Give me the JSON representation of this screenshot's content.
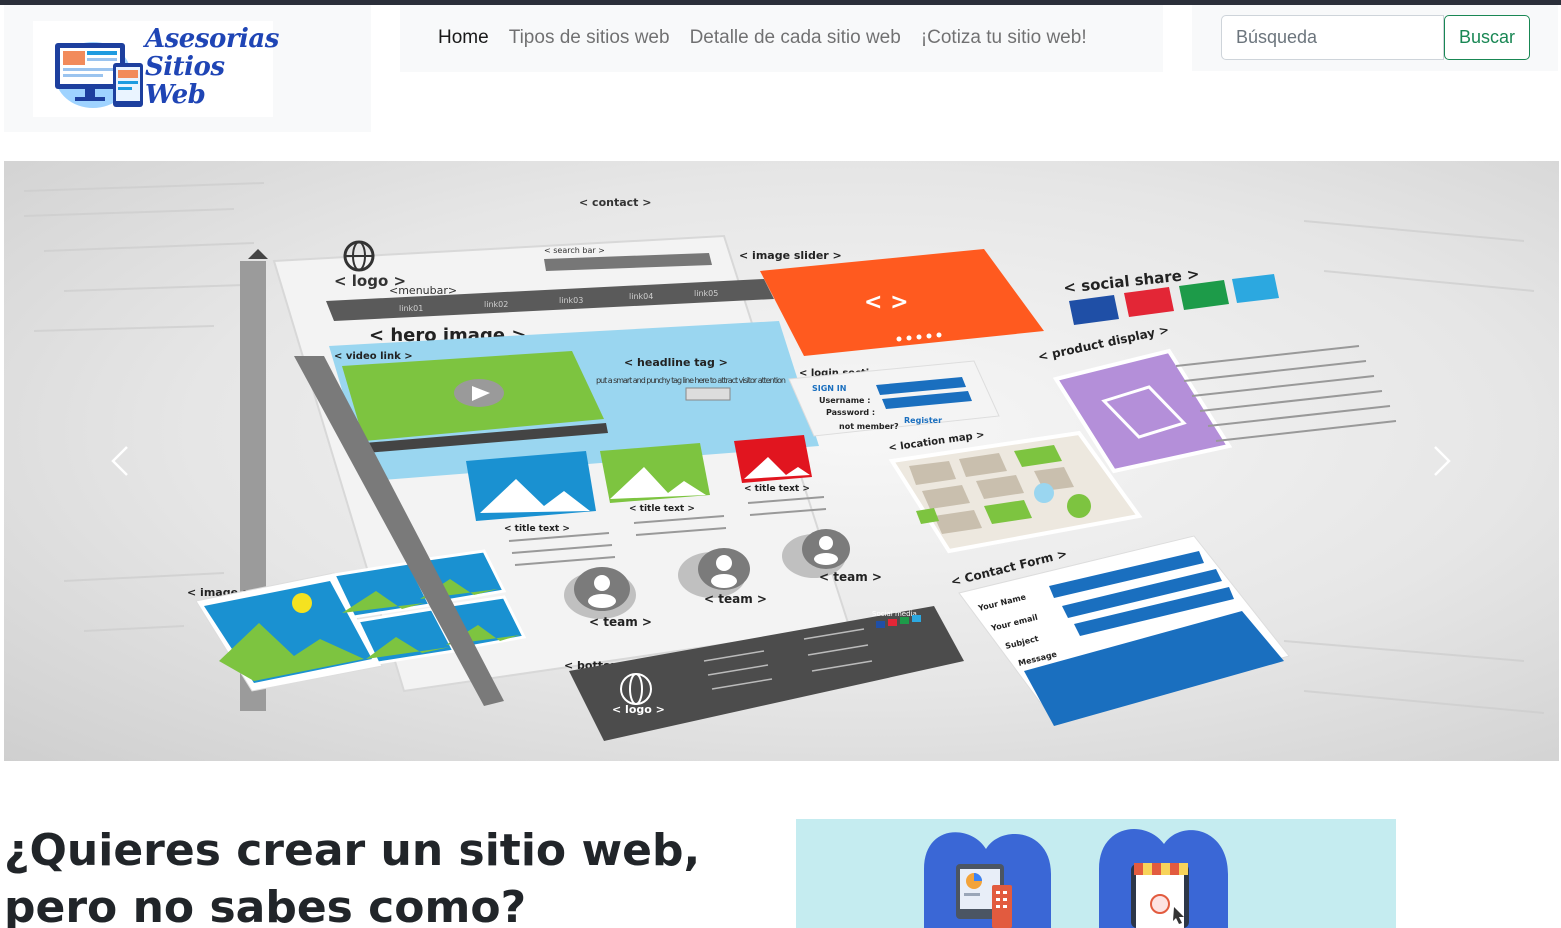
{
  "brand": {
    "logo_text_lines": [
      "Asesorias",
      "Sitios",
      "Web"
    ],
    "logo_color": "#1f45b5"
  },
  "nav": {
    "items": [
      {
        "label": "Home",
        "active": true
      },
      {
        "label": "Tipos de sitios web",
        "active": false
      },
      {
        "label": "Detalle de cada sitio web",
        "active": false
      },
      {
        "label": "¡Cotiza tu sitio web!",
        "active": false
      }
    ]
  },
  "search": {
    "placeholder": "Búsqueda",
    "button_label": "Buscar",
    "button_color": "#198754"
  },
  "carousel": {
    "slide_labels": {
      "contact": "< contact >",
      "logo": "< logo >",
      "menubar": "<menubar>",
      "search_bar": "< search bar >",
      "image_slider": "< image slider >",
      "social_share": "< social share >",
      "hero_image": "< hero image >",
      "video_link": "< video link >",
      "headline_tag": "< headline tag >",
      "headline_sub": "put a smart and punchy tag line here to attract visitor attention",
      "login_section": "< login section >",
      "product_display": "< product display >",
      "location_map": "< location map >",
      "title_text": "< title text >",
      "image_gallery": "< image gallery >",
      "team": "< team >",
      "contact_form": "< Contact Form >",
      "your_name": "Your Name",
      "your_email": "Your email",
      "subject": "Subject",
      "message": "Message",
      "bottom_menu": "< bottom menu >",
      "social_media": "Social media",
      "sign_in": "SIGN IN",
      "username": "Username :",
      "password": "Password :",
      "not_member": "not member?",
      "register": "Register"
    },
    "social_colors": [
      "#1f4fa6",
      "#e32636",
      "#1d9b49",
      "#2ca8e0"
    ],
    "prev_icon": "chevron-left-icon",
    "next_icon": "chevron-right-icon"
  },
  "main": {
    "headline": "¿Quieres crear un sitio web, pero no sabes como?"
  },
  "colors": {
    "accent_green": "#198754",
    "nav_bg": "#f8f9fa",
    "promo_bg": "#c5ecf0"
  }
}
